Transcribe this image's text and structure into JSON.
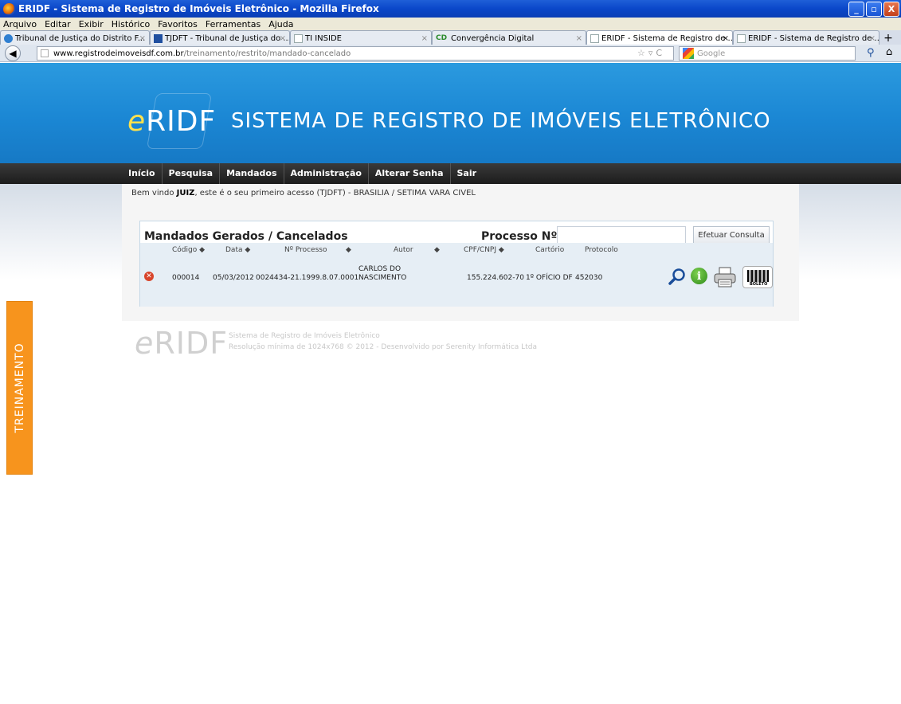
{
  "window": {
    "title": "ERIDF - Sistema de Registro de Imóveis Eletrônico - Mozilla Firefox",
    "buttons": {
      "minimize": "_",
      "maximize": "▫",
      "close": "X"
    }
  },
  "menu": [
    "Arquivo",
    "Editar",
    "Exibir",
    "Histórico",
    "Favoritos",
    "Ferramentas",
    "Ajuda"
  ],
  "tabs": [
    {
      "label": "Tribunal de Justiça do Distrito F...",
      "icon": "globe-icon"
    },
    {
      "label": "TJDFT - Tribunal de Justiça do ...",
      "icon": "tjdft-icon"
    },
    {
      "label": "TI INSIDE",
      "icon": "page-icon"
    },
    {
      "label": "Convergência Digital",
      "icon": "cd-icon",
      "icon_text": "CD"
    },
    {
      "label": "ERIDF - Sistema de Registro de ...",
      "icon": "page-icon",
      "active": true
    },
    {
      "label": "ERIDF - Sistema de Registro de ...",
      "icon": "page-icon"
    }
  ],
  "nav": {
    "url_host": "www.registrodeimoveisdf.com.br",
    "url_path": "/treinamento/restrito/mandado-cancelado",
    "search_placeholder": "Google"
  },
  "site": {
    "logo_e": "e",
    "logo_rest": "RIDF",
    "slogan": "SISTEMA DE REGISTRO DE IMÓVEIS ELETRÔNICO",
    "menu": [
      "Início",
      "Pesquisa",
      "Mandados",
      "Administração",
      "Alterar Senha",
      "Sair"
    ],
    "welcome_prefix": "Bem vindo",
    "welcome_user": "JUIZ",
    "welcome_suffix": ", este é o seu primeiro acesso (TJDFT) - BRASILIA / SETIMA VARA CIVEL",
    "side_tab": "TREINAMENTO"
  },
  "panel": {
    "title": "Mandados Gerados / Cancelados",
    "process_label": "Processo Nº:",
    "process_value": "",
    "button": "Efetuar Consulta",
    "columns": [
      "Código ◆",
      "Data ◆",
      "Nº Processo",
      "◆",
      "Autor",
      "◆",
      "CPF/CNPJ ◆",
      "Cartório",
      "Protocolo"
    ],
    "rows": [
      {
        "codigo": "000014",
        "data": "05/03/2012",
        "processo": "0024434-21.1999.8.07.0001",
        "autor_l1": "CARLOS DO",
        "autor_l2": "NASCIMENTO",
        "cpf": "155.224.602-70",
        "cartorio": "1º OFÍCIO DF",
        "protocolo": "452030",
        "boleto_label": "BOLETO"
      }
    ]
  },
  "footer": {
    "logo_e": "e",
    "logo_rest": "RIDF",
    "line1": "Sistema de Registro de Imóveis Eletrônico",
    "line2": "Resolução mínima de 1024x768 © 2012 - Desenvolvido por Serenity Informática Ltda"
  }
}
